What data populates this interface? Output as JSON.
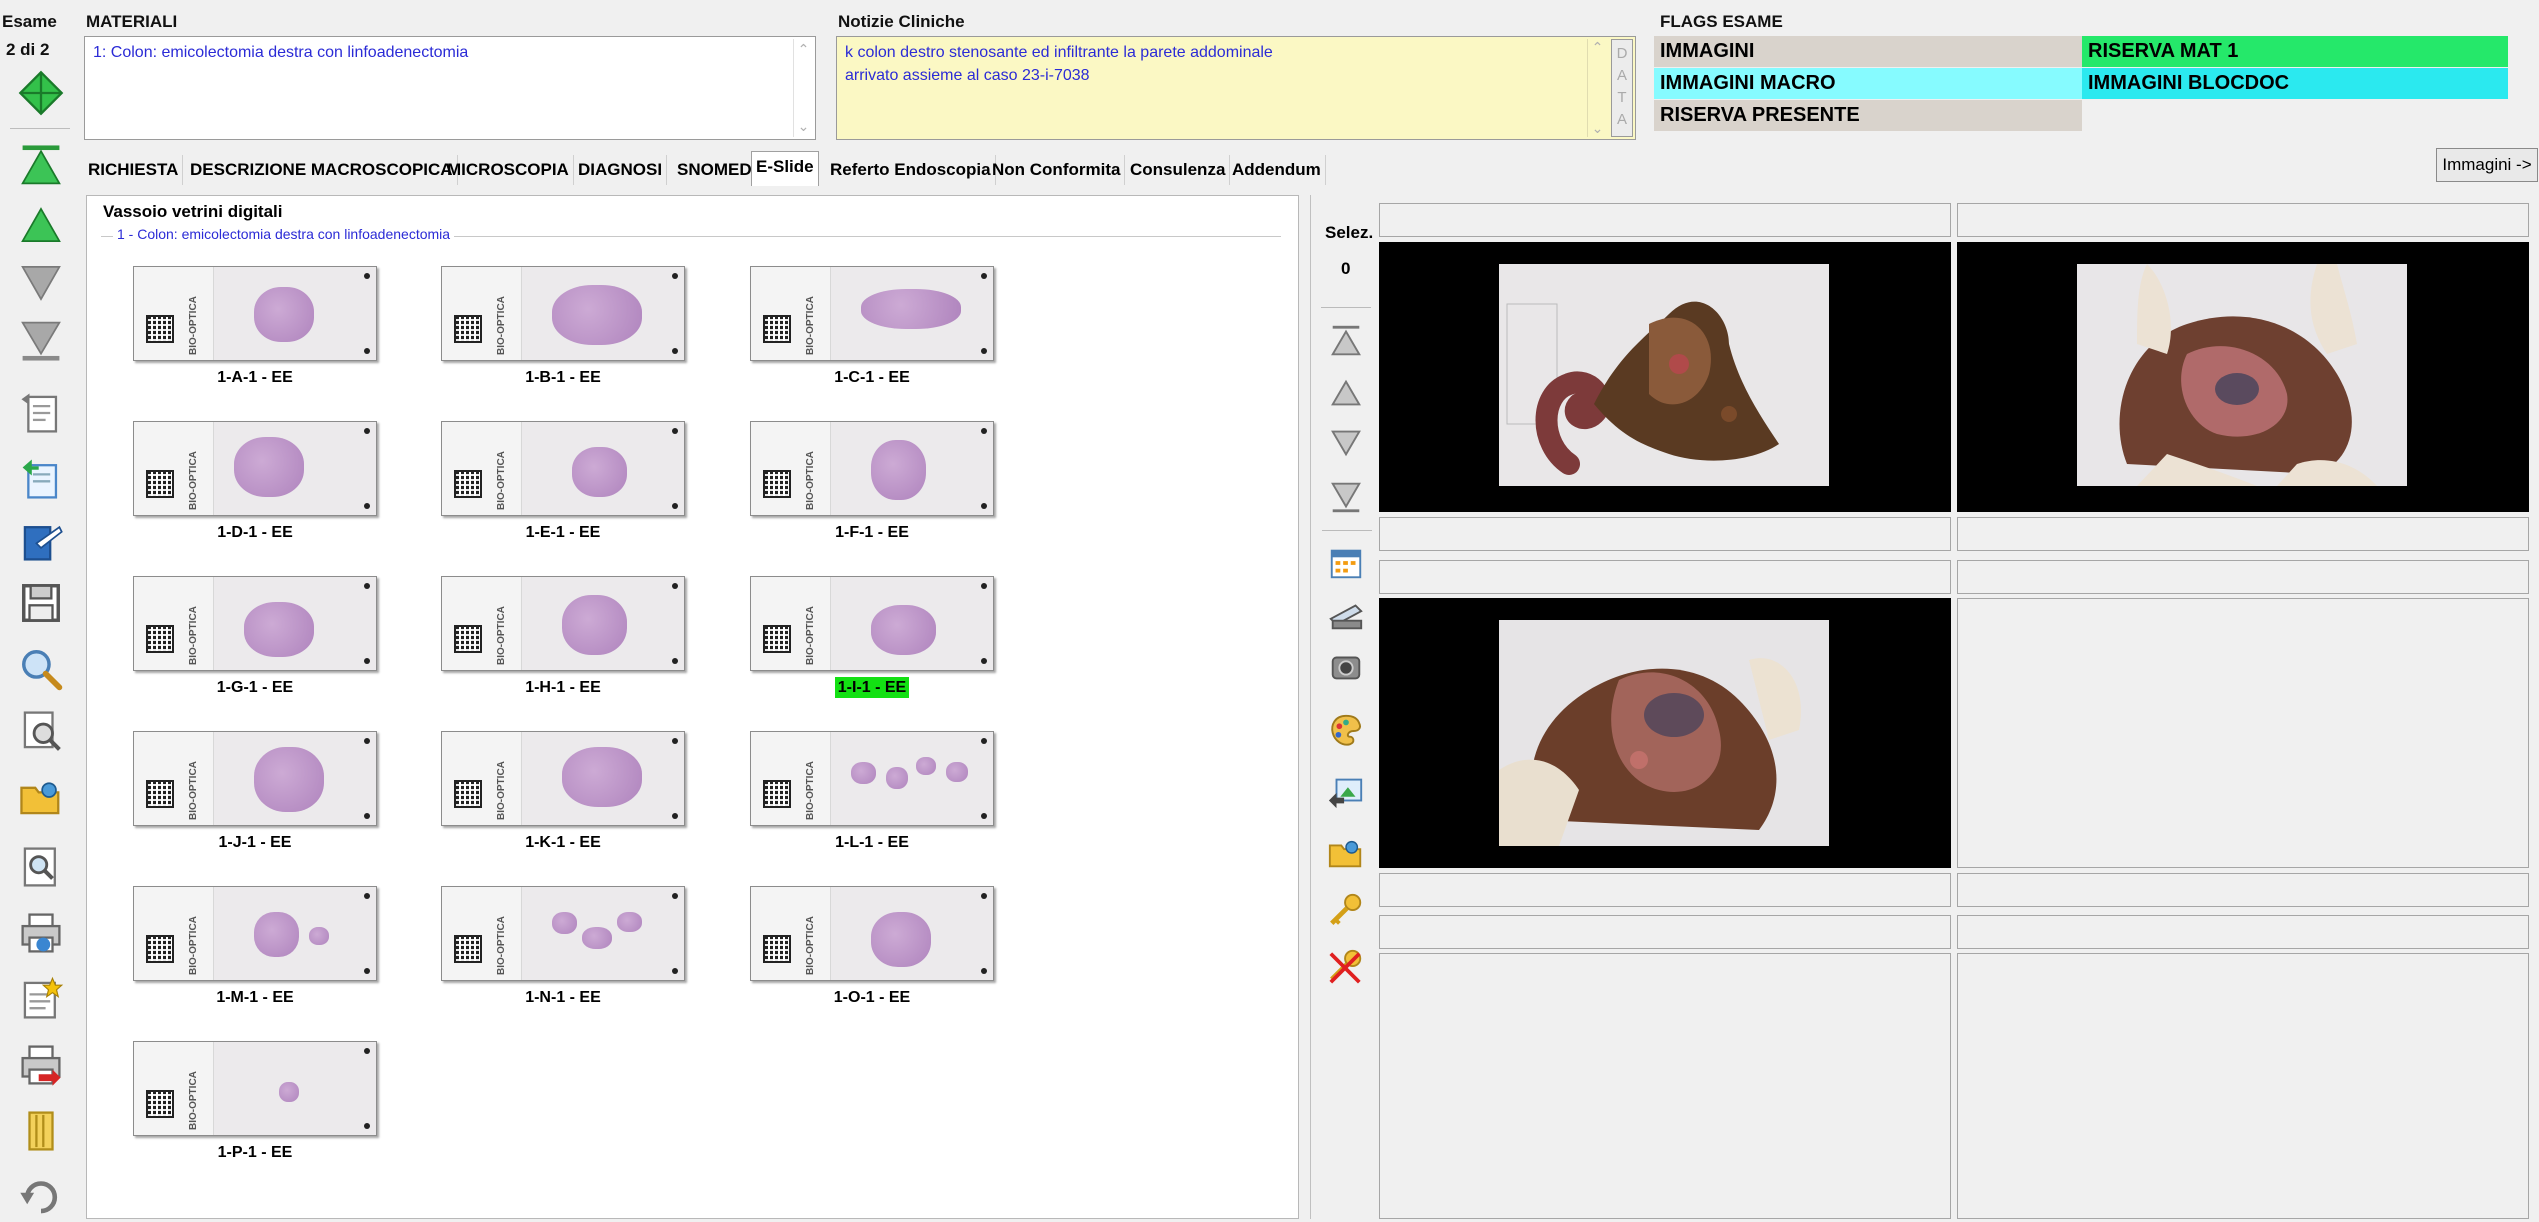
{
  "exam": {
    "label": "Esame",
    "counter": "2 di 2"
  },
  "materials": {
    "header": "MATERIALI",
    "value": "1: Colon: emicolectomia destra con linfoadenectomia"
  },
  "clinical_notes": {
    "header": "Notizie Cliniche",
    "value": "k colon destro stenosante ed infiltrante la parete addominale\narrivato assieme al caso 23-i-7038",
    "side_button": "D\nA\nT\nA"
  },
  "flags": {
    "header": "FLAGS ESAME",
    "items": [
      {
        "label": "IMMAGINI",
        "color": "#d9d3cc"
      },
      {
        "label": "RISERVA MAT 1",
        "color": "#25e86a"
      },
      {
        "label": "IMMAGINI MACRO",
        "color": "#86fbff"
      },
      {
        "label": "IMMAGINI BLOCDOC",
        "color": "#2be9ef"
      },
      {
        "label": "RISERVA PRESENTE",
        "color": "#d9d3cc"
      }
    ]
  },
  "tabs": [
    {
      "label": "RICHIESTA",
      "active": false
    },
    {
      "label": "DESCRIZIONE MACROSCOPICA",
      "active": false
    },
    {
      "label": "MICROSCOPIA",
      "active": false
    },
    {
      "label": "DIAGNOSI",
      "active": false
    },
    {
      "label": "SNOMED",
      "active": false
    },
    {
      "label": "E-Slide",
      "active": true
    },
    {
      "label": "Referto Endoscopia",
      "active": false
    },
    {
      "label": "Non Conformita",
      "active": false
    },
    {
      "label": "Consulenza",
      "active": false
    },
    {
      "label": "Addendum",
      "active": false
    }
  ],
  "images_button": "Immagini ->",
  "tray": {
    "title": "Vassoio vetrini digitali",
    "group_label": "1 - Colon: emicolectomia destra con linfoadenectomia",
    "slide_brand": "BIO-OPTICA",
    "slides": [
      {
        "label": "1-A-1 - EE",
        "selected": false
      },
      {
        "label": "1-B-1 - EE",
        "selected": false
      },
      {
        "label": "1-C-1 - EE",
        "selected": false
      },
      {
        "label": "1-D-1 - EE",
        "selected": false
      },
      {
        "label": "1-E-1 - EE",
        "selected": false
      },
      {
        "label": "1-F-1 - EE",
        "selected": false
      },
      {
        "label": "1-G-1 - EE",
        "selected": false
      },
      {
        "label": "1-H-1 - EE",
        "selected": false
      },
      {
        "label": "1-I-1 - EE",
        "selected": true
      },
      {
        "label": "1-J-1 - EE",
        "selected": false
      },
      {
        "label": "1-K-1 - EE",
        "selected": false
      },
      {
        "label": "1-L-1 - EE",
        "selected": false
      },
      {
        "label": "1-M-1 - EE",
        "selected": false
      },
      {
        "label": "1-N-1 - EE",
        "selected": false
      },
      {
        "label": "1-O-1 - EE",
        "selected": false
      },
      {
        "label": "1-P-1 - EE",
        "selected": false
      }
    ]
  },
  "selection": {
    "label": "Selez.",
    "count": "0"
  },
  "images": {
    "cells": [
      {
        "has_image": true
      },
      {
        "has_image": true
      },
      {
        "has_image": true
      },
      {
        "has_image": false
      },
      {
        "has_image": false
      },
      {
        "has_image": false
      }
    ]
  }
}
